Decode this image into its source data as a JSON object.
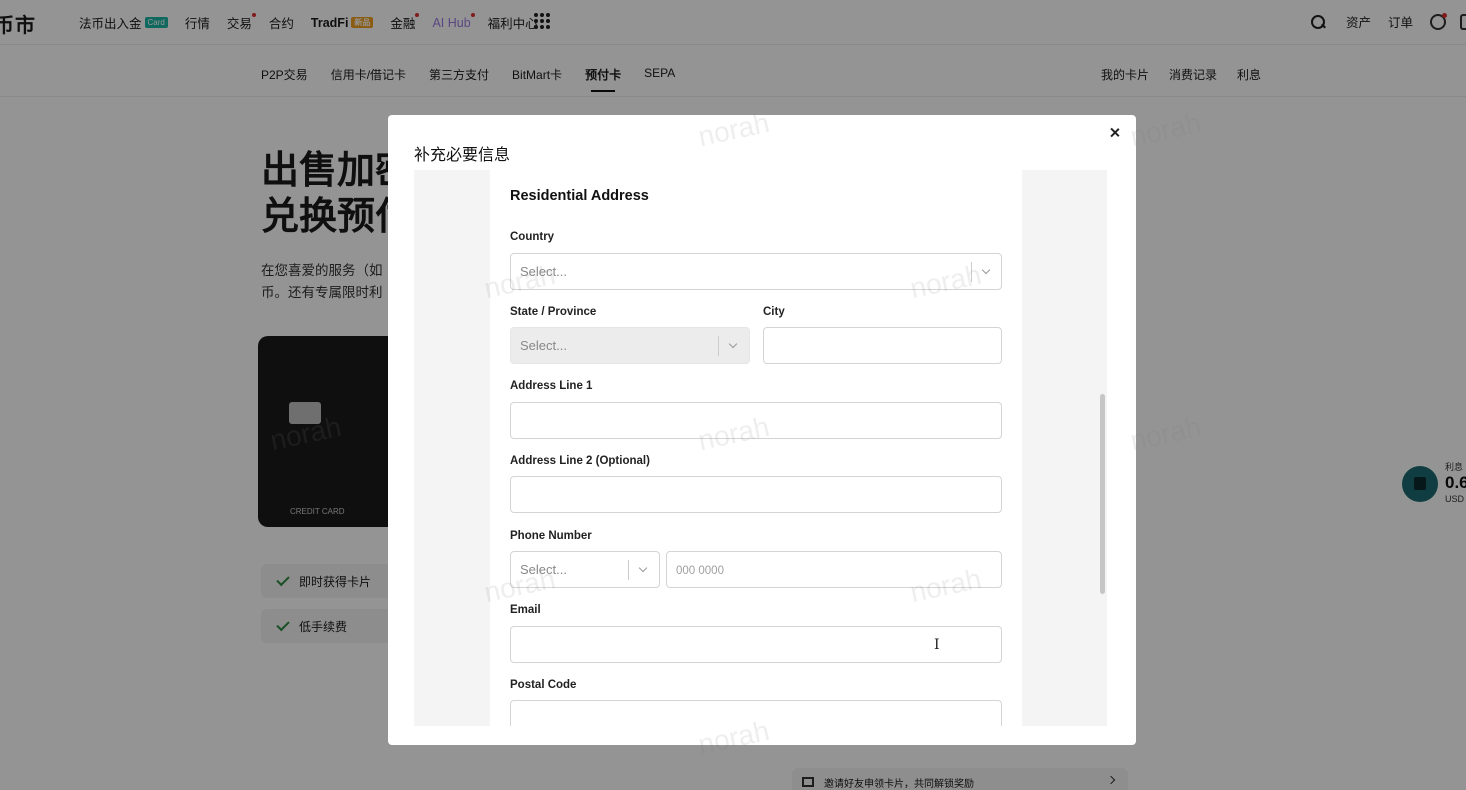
{
  "topnav": {
    "logo": "币市",
    "items": [
      {
        "label": "法币出入金",
        "badge": "Card"
      },
      {
        "label": "行情"
      },
      {
        "label": "交易",
        "dot": true
      },
      {
        "label": "合约"
      },
      {
        "label": "TradFi",
        "badge": "新品"
      },
      {
        "label": "金融",
        "dot": true
      },
      {
        "label": "AI Hub",
        "dot": true
      },
      {
        "label": "福利中心"
      }
    ],
    "right": [
      "资产",
      "订单"
    ]
  },
  "subnav": {
    "items": [
      "P2P交易",
      "信用卡/借记卡",
      "第三方支付",
      "BitMart卡",
      "预付卡",
      "SEPA"
    ],
    "active": "预付卡",
    "right": [
      "我的卡片",
      "消费记录",
      "利息"
    ]
  },
  "page": {
    "hero_line1": "出售加密",
    "hero_line2": "兑换预付",
    "desc_line1": "在您喜爱的服务（如",
    "desc_line2": "币。还有专属限时利",
    "card_label": "CREDIT CARD",
    "features": [
      "即时获得卡片",
      "低手续费"
    ],
    "invite": "邀请好友申领卡片，共同解锁奖励",
    "float_label": "利息",
    "float_value": "0.6",
    "float_unit": "USD"
  },
  "modal": {
    "title": "补充必要信息",
    "section_title": "Residential Address",
    "country_label": "Country",
    "country_value": "Select...",
    "state_label": "State / Province",
    "state_value": "Select...",
    "city_label": "City",
    "address1_label": "Address Line 1",
    "address2_label": "Address Line 2 (Optional)",
    "phone_label": "Phone Number",
    "phone_code_value": "Select...",
    "phone_placeholder": "000 0000",
    "email_label": "Email",
    "postal_label": "Postal Code"
  },
  "watermark": "norah"
}
